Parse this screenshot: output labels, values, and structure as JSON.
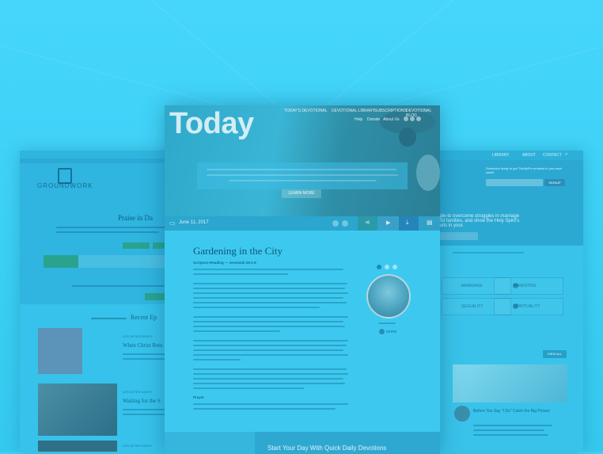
{
  "left_site": {
    "logo_text": "GROUNDWORK",
    "hero_heading": "Praise in Da",
    "section_heading": "Recent Ep",
    "episodes": [
      {
        "tag": "LIFE AFTER DEATH",
        "title": "When Christ Retu"
      },
      {
        "tag": "LIFE AFTER DEATH",
        "title": "Waiting for the S"
      },
      {
        "tag": "LIFE AFTER DEATH",
        "title": ""
      }
    ]
  },
  "center_site": {
    "nav": [
      "TODAY'S DEVOTIONAL",
      "DEVOTIONAL LIBRARY",
      "SUBSCRIPTIONS",
      "DEVOTIONAL BLOG"
    ],
    "subnav": [
      "Help",
      "Donate",
      "About Us"
    ],
    "hero_title": "Today",
    "learn_more": "LEARN MORE",
    "date": "June 11, 2017",
    "article_title": "Gardening in the City",
    "scripture_label": "Scripture Reading — Jeremiah 29:1-9",
    "prayer_label": "Prayer",
    "more_label": "MORE",
    "footer_text": "Start Your Day With Quick Daily Devotions"
  },
  "right_site": {
    "nav": [
      "LIBRARY",
      "ABOUT",
      "CONTACT"
    ],
    "subscribe_text": "Subscribe today to get ThirdlyPro emailed to you each week!",
    "signup_button": "SIGNUP",
    "hero_text": "ngle-to overcome struggles in marriage and families, and show the Holy Spirit's fruits in your.",
    "tiles": [
      "MARRIAGE",
      "PARENTING",
      "SEXUALITY",
      "SPIRITUALITY"
    ],
    "view_all": "VIEW ALL",
    "post_title": "Before You Say \"I Do\" Catch the Big Picture"
  },
  "colors": {
    "background": "#3fd0f5",
    "overlay_tint": "#3cc6ec",
    "title_color": "#0e5677"
  }
}
